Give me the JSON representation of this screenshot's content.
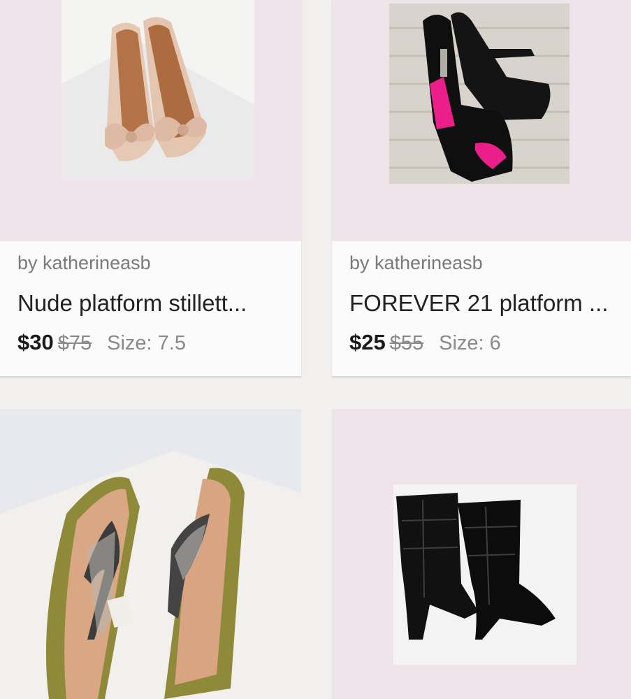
{
  "listings": [
    {
      "seller": "by katherineasb",
      "title": "Nude platform stillett...",
      "price": "$30",
      "original_price": "$75",
      "size": "Size: 7.5",
      "image_icon": "nude-bow-platform-heels"
    },
    {
      "seller": "by katherineasb",
      "title": "FOREVER 21 platform ...",
      "price": "$25",
      "original_price": "$55",
      "size": "Size: 6",
      "image_icon": "black-pink-peeptoe-heels"
    },
    {
      "image_icon": "jeweled-thong-wedge-sandals"
    },
    {
      "image_icon": "black-croc-heeled-boots"
    }
  ],
  "colors": {
    "page_bg": "#f2f0ee",
    "card_image_bg": "#efe4ea",
    "price_text": "#1a1a1a",
    "muted_text": "#7a7a7a"
  }
}
